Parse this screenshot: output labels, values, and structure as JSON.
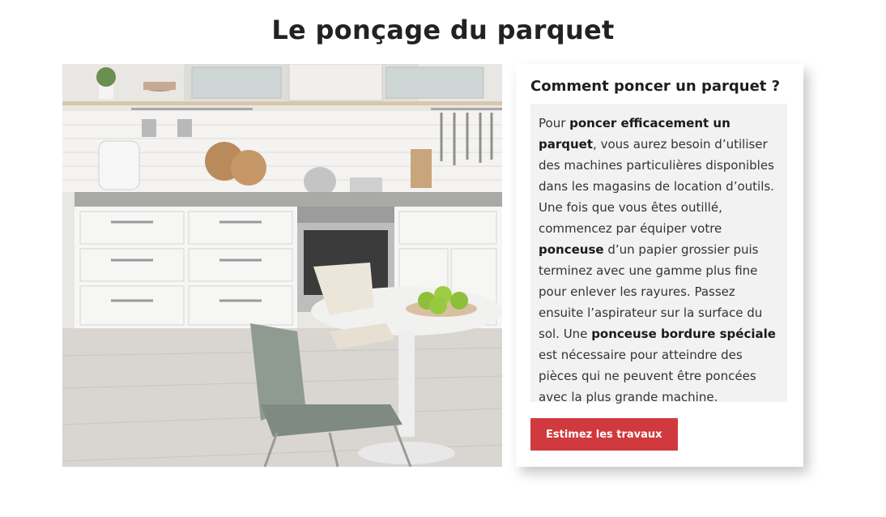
{
  "page": {
    "title": "Le ponçage du parquet"
  },
  "card": {
    "heading": "Comment poncer un parquet ?",
    "body": {
      "p1_pre": "Pour ",
      "p1_bold": "poncer efficacement un parquet",
      "p1_post": ", vous aurez besoin d’utiliser des machines particulières disponibles dans les magasins de location d’outils.",
      "p2_pre": "Une fois que vous êtes outillé, commencez par équiper votre ",
      "p2_bold1": "ponceuse",
      "p2_mid": " d’un papier grossier puis terminez avec une gamme plus fine pour enlever les rayures. Passez ensuite l’aspirateur sur la surface du sol. Une ",
      "p2_bold2": "ponceuse bordure spéciale",
      "p2_post": " est nécessaire  pour atteindre des pièces qui ne peuvent être poncées avec la plus grande machine."
    },
    "button_label": "Estimez les travaux"
  },
  "colors": {
    "button_bg": "#d0393e",
    "text_box_bg": "#f2f2f2"
  }
}
